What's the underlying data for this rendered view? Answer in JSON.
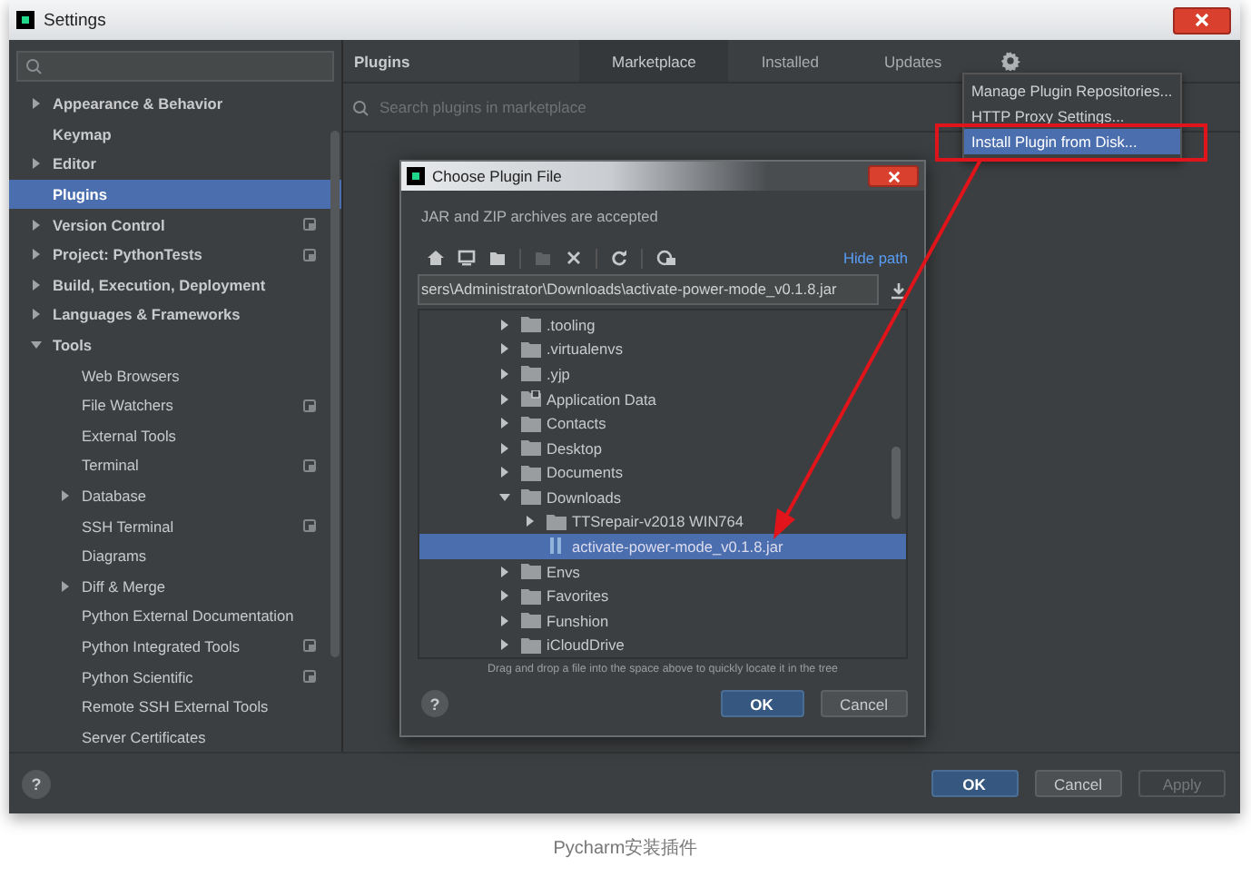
{
  "window": {
    "title": "Settings"
  },
  "sidebar": {
    "items": [
      {
        "label": "Appearance & Behavior",
        "expanded": false,
        "badge": false,
        "selected": false
      },
      {
        "label": "Keymap",
        "badge": false,
        "selected": false
      },
      {
        "label": "Editor",
        "expanded": false,
        "badge": false,
        "selected": false
      },
      {
        "label": "Plugins",
        "badge": false,
        "selected": true
      },
      {
        "label": "Version Control",
        "expanded": false,
        "badge": true,
        "selected": false
      },
      {
        "label": "Project: PythonTests",
        "expanded": false,
        "badge": true,
        "selected": false
      },
      {
        "label": "Build, Execution, Deployment",
        "expanded": false,
        "badge": false,
        "selected": false
      },
      {
        "label": "Languages & Frameworks",
        "expanded": false,
        "badge": false,
        "selected": false
      },
      {
        "label": "Tools",
        "expanded": true,
        "badge": false,
        "selected": false,
        "children": [
          {
            "label": "Web Browsers",
            "badge": false,
            "selected": false
          },
          {
            "label": "File Watchers",
            "badge": true,
            "selected": false
          },
          {
            "label": "External Tools",
            "badge": false,
            "selected": false
          },
          {
            "label": "Terminal",
            "badge": true,
            "selected": false
          },
          {
            "label": "Database",
            "expanded": false,
            "badge": false,
            "selected": false
          },
          {
            "label": "SSH Terminal",
            "badge": true,
            "selected": false
          },
          {
            "label": "Diagrams",
            "badge": false,
            "selected": false
          },
          {
            "label": "Diff & Merge",
            "expanded": false,
            "badge": false,
            "selected": false
          },
          {
            "label": "Python External Documentation",
            "badge": false,
            "selected": false
          },
          {
            "label": "Python Integrated Tools",
            "badge": true,
            "selected": false
          },
          {
            "label": "Python Scientific",
            "badge": true,
            "selected": false
          },
          {
            "label": "Remote SSH External Tools",
            "badge": false,
            "selected": false
          },
          {
            "label": "Server Certificates",
            "badge": false,
            "selected": false
          }
        ]
      }
    ]
  },
  "content": {
    "title": "Plugins",
    "tabs": [
      {
        "label": "Marketplace",
        "selected": true
      },
      {
        "label": "Installed",
        "selected": false
      },
      {
        "label": "Updates",
        "selected": false
      }
    ],
    "search": {
      "placeholder": "Search plugins in marketplace"
    },
    "menu": [
      {
        "label": "Manage Plugin Repositories...",
        "selected": false
      },
      {
        "label": "HTTP Proxy Settings...",
        "selected": false
      },
      {
        "label": "Install Plugin from Disk...",
        "selected": true
      }
    ]
  },
  "dialog": {
    "title": "Choose Plugin File",
    "subtitle": "JAR and ZIP archives are accepted",
    "hide_path": "Hide path",
    "path": "sers\\Administrator\\Downloads\\activate-power-mode_v0.1.8.jar",
    "tree": [
      {
        "label": ".tooling",
        "kind": "folder",
        "expanded": false,
        "selected": false
      },
      {
        "label": ".virtualenvs",
        "kind": "folder",
        "expanded": false,
        "selected": false
      },
      {
        "label": ".yjp",
        "kind": "folder",
        "expanded": false,
        "selected": false
      },
      {
        "label": "Application Data",
        "kind": "link",
        "expanded": false,
        "selected": false
      },
      {
        "label": "Contacts",
        "kind": "folder",
        "expanded": false,
        "selected": false
      },
      {
        "label": "Desktop",
        "kind": "folder",
        "expanded": false,
        "selected": false
      },
      {
        "label": "Documents",
        "kind": "folder",
        "expanded": false,
        "selected": false
      },
      {
        "label": "Downloads",
        "kind": "folder",
        "expanded": true,
        "selected": false,
        "children": [
          {
            "label": "TTSrepair-v2018 WIN764",
            "kind": "folder",
            "expanded": false,
            "selected": false
          },
          {
            "label": "activate-power-mode_v0.1.8.jar",
            "kind": "file",
            "selected": true
          }
        ]
      },
      {
        "label": "Envs",
        "kind": "folder",
        "expanded": false,
        "selected": false
      },
      {
        "label": "Favorites",
        "kind": "folder",
        "expanded": false,
        "selected": false
      },
      {
        "label": "Funshion",
        "kind": "folder",
        "expanded": false,
        "selected": false
      },
      {
        "label": "iCloudDrive",
        "kind": "folder",
        "expanded": false,
        "selected": false
      }
    ],
    "hint": "Drag and drop a file into the space above to quickly locate it in the tree",
    "help": "?",
    "buttons": [
      {
        "label": "OK",
        "default": true,
        "disabled": false
      },
      {
        "label": "Cancel",
        "default": false,
        "disabled": false
      }
    ]
  },
  "help": "?",
  "buttons": [
    {
      "label": "OK",
      "default": true,
      "disabled": false
    },
    {
      "label": "Cancel",
      "default": false,
      "disabled": false
    },
    {
      "label": "Apply",
      "default": false,
      "disabled": true
    }
  ],
  "caption": "Pycharm安装插件"
}
